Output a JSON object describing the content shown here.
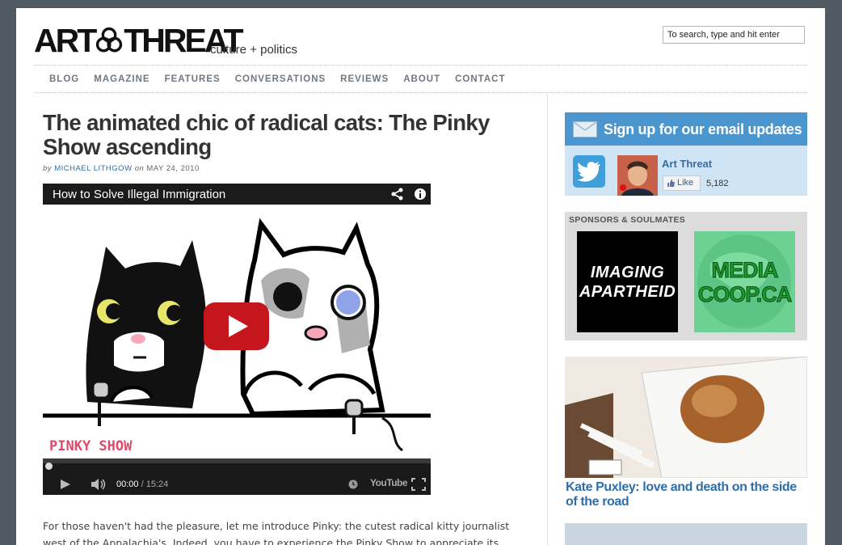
{
  "header": {
    "logo_left": "ART",
    "logo_right": "THREAT",
    "tagline": "culture + politics",
    "search_placeholder": "To search, type and hit enter"
  },
  "nav": [
    "BLOG",
    "MAGAZINE",
    "FEATURES",
    "CONVERSATIONS",
    "REVIEWS",
    "ABOUT",
    "CONTACT"
  ],
  "article": {
    "title": "The animated chic of radical cats: The Pinky Show ascending",
    "by_prefix": "by",
    "author": "MICHAEL LITHGOW",
    "date_prefix": "on",
    "date": "MAY 24, 2010",
    "body": "For those haven't had the pleasure, let me introduce Pinky: the cutest radical kitty journalist west of the Appalachia's. Indeed, you have to experience the Pinky Show to appreciate its"
  },
  "video": {
    "title": "How to Solve Illegal Immigration",
    "current_time": "00:00",
    "separator": "/",
    "total_time": "15:24",
    "brand": "YouTube",
    "watermark": "PINKY SHOW",
    "icons": [
      "share-icon",
      "info-icon",
      "play-icon",
      "volume-icon",
      "clock-icon",
      "fullscreen-icon"
    ]
  },
  "sidebar": {
    "signup_text": "Sign up for our email updates",
    "fb_name": "Art Threat",
    "like_label": "Like",
    "like_count": "5,182",
    "sponsors_heading": "SPONSORS & SOULMATES",
    "sponsor1_line1": "IMAGING",
    "sponsor1_line2": "APARTHEID",
    "sponsor2_line1": "MEDIA",
    "sponsor2_line2": "COOP.CA",
    "feature_caption": "Kate Puxley: love and death on the side of the road"
  },
  "colors": {
    "background": "#4f5a63",
    "accent": "#4c96cf",
    "link": "#2e6ea9",
    "nav": "#6f7880"
  }
}
